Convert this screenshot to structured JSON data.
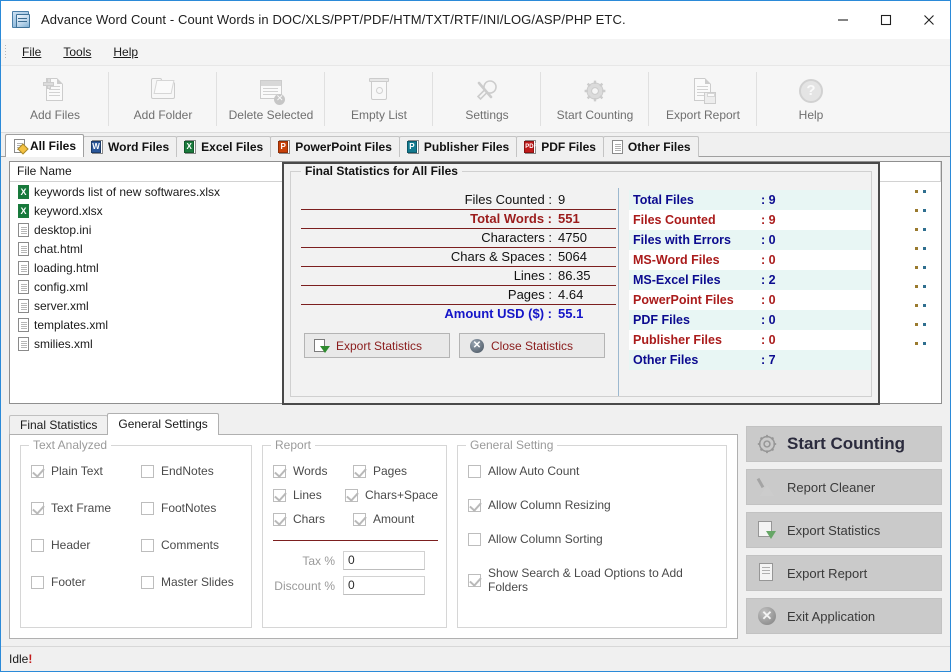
{
  "window": {
    "title": "Advance Word Count - Count Words in DOC/XLS/PPT/PDF/HTM/TXT/RTF/INI/LOG/ASP/PHP ETC.",
    "minimize": "Minimize",
    "maximize": "Maximize",
    "close": "Close"
  },
  "menu": {
    "items": [
      "File",
      "Tools",
      "Help"
    ]
  },
  "toolbar": {
    "items": [
      {
        "label": "Add Files",
        "icon": "add-files-icon"
      },
      {
        "label": "Add Folder",
        "icon": "add-folder-icon"
      },
      {
        "label": "Delete Selected",
        "icon": "delete-selected-icon"
      },
      {
        "label": "Empty List",
        "icon": "empty-list-icon"
      },
      {
        "label": "Settings",
        "icon": "settings-icon"
      },
      {
        "label": "Start Counting",
        "icon": "start-counting-icon"
      },
      {
        "label": "Export Report",
        "icon": "export-report-icon"
      },
      {
        "label": "Help",
        "icon": "help-icon"
      }
    ]
  },
  "file_tabs": {
    "active": "All Files",
    "items": [
      {
        "label": "All Files",
        "icon": "all-files-icon"
      },
      {
        "label": "Word Files",
        "icon": "word-icon"
      },
      {
        "label": "Excel Files",
        "icon": "excel-icon"
      },
      {
        "label": "PowerPoint Files",
        "icon": "powerpoint-icon"
      },
      {
        "label": "Publisher Files",
        "icon": "publisher-icon"
      },
      {
        "label": "PDF Files",
        "icon": "pdf-icon"
      },
      {
        "label": "Other Files",
        "icon": "other-icon"
      }
    ]
  },
  "file_list": {
    "columns": [
      "File Name",
      "",
      "",
      "",
      "",
      "",
      ""
    ],
    "rows": [
      {
        "name": "keywords list of new softwares.xlsx",
        "type": "xls"
      },
      {
        "name": "keyword.xlsx",
        "type": "xls"
      },
      {
        "name": "desktop.ini",
        "type": "txt"
      },
      {
        "name": "chat.html",
        "type": "txt"
      },
      {
        "name": "loading.html",
        "type": "txt"
      },
      {
        "name": "config.xml",
        "type": "txt"
      },
      {
        "name": "server.xml",
        "type": "txt"
      },
      {
        "name": "templates.xml",
        "type": "txt"
      },
      {
        "name": "smilies.xml",
        "type": "txt"
      }
    ]
  },
  "stats_dialog": {
    "title": "Final Statistics for All Files",
    "left_rows": [
      {
        "label": "Files Counted :",
        "value": "9",
        "style": "normal"
      },
      {
        "label": "Total Words :",
        "value": "551",
        "style": "highlight"
      },
      {
        "label": "Characters :",
        "value": "4750",
        "style": "normal"
      },
      {
        "label": "Chars & Spaces :",
        "value": "5064",
        "style": "normal"
      },
      {
        "label": "Lines :",
        "value": "86.35",
        "style": "normal"
      },
      {
        "label": "Pages :",
        "value": "4.64",
        "style": "normal"
      },
      {
        "label": "Amount USD ($) :",
        "value": "55.1",
        "style": "amount"
      }
    ],
    "buttons": [
      {
        "label": "Export Statistics",
        "icon": "export-statistics-icon"
      },
      {
        "label": "Close Statistics",
        "icon": "close-statistics-icon"
      }
    ],
    "right_rows": [
      {
        "key": "Total Files",
        "value": ": 9",
        "color": "blue"
      },
      {
        "key": "Files Counted",
        "value": ": 9",
        "color": "red"
      },
      {
        "key": "Files with Errors",
        "value": ": 0",
        "color": "blue"
      },
      {
        "key": "MS-Word Files",
        "value": ": 0",
        "color": "red"
      },
      {
        "key": "MS-Excel Files",
        "value": ": 2",
        "color": "blue"
      },
      {
        "key": "PowerPoint Files",
        "value": ": 0",
        "color": "red"
      },
      {
        "key": "PDF Files",
        "value": ": 0",
        "color": "blue"
      },
      {
        "key": "Publisher Files",
        "value": ": 0",
        "color": "red"
      },
      {
        "key": "Other Files",
        "value": ": 7",
        "color": "blue"
      }
    ]
  },
  "bottom_tabs": {
    "active": "General Settings",
    "items": [
      "Final Statistics",
      "General Settings"
    ]
  },
  "settings": {
    "text_analyzed": {
      "title": "Text Analyzed",
      "items": [
        {
          "label": "Plain Text",
          "checked": true
        },
        {
          "label": "EndNotes",
          "checked": false
        },
        {
          "label": "Text Frame",
          "checked": true
        },
        {
          "label": "FootNotes",
          "checked": false
        },
        {
          "label": "Header",
          "checked": false
        },
        {
          "label": "Comments",
          "checked": false
        },
        {
          "label": "Footer",
          "checked": false
        },
        {
          "label": "Master Slides",
          "checked": false
        }
      ]
    },
    "report": {
      "title": "Report",
      "items": [
        {
          "label": "Words",
          "checked": true
        },
        {
          "label": "Pages",
          "checked": true
        },
        {
          "label": "Lines",
          "checked": true
        },
        {
          "label": "Chars+Space",
          "checked": true
        },
        {
          "label": "Chars",
          "checked": true
        },
        {
          "label": "Amount",
          "checked": true
        }
      ],
      "tax_label": "Tax %",
      "tax_value": "0",
      "discount_label": "Discount %",
      "discount_value": "0"
    },
    "general": {
      "title": "General Setting",
      "items": [
        {
          "label": "Allow Auto Count",
          "checked": false
        },
        {
          "label": "Allow Column Resizing",
          "checked": true
        },
        {
          "label": "Allow Column Sorting",
          "checked": false
        },
        {
          "label": "Show Search & Load Options to Add Folders",
          "checked": true
        }
      ]
    }
  },
  "actions": [
    {
      "label": "Start Counting",
      "icon": "gear-icon",
      "primary": true
    },
    {
      "label": "Report Cleaner",
      "icon": "broom-icon",
      "primary": false
    },
    {
      "label": "Export Statistics",
      "icon": "export-statistics-icon",
      "primary": false
    },
    {
      "label": "Export Report",
      "icon": "export-report-icon",
      "primary": false
    },
    {
      "label": "Exit Application",
      "icon": "exit-icon",
      "primary": false
    }
  ],
  "status": {
    "text": "Idle",
    "bang": "!"
  },
  "colors": {
    "accent": "#2b8ad8",
    "stat_red": "#9b1c1c",
    "stat_blue": "#1414c8",
    "row_blue": "#0b0b8f",
    "row_red": "#aa1b1b",
    "row_bg": "#e8f6f4"
  }
}
